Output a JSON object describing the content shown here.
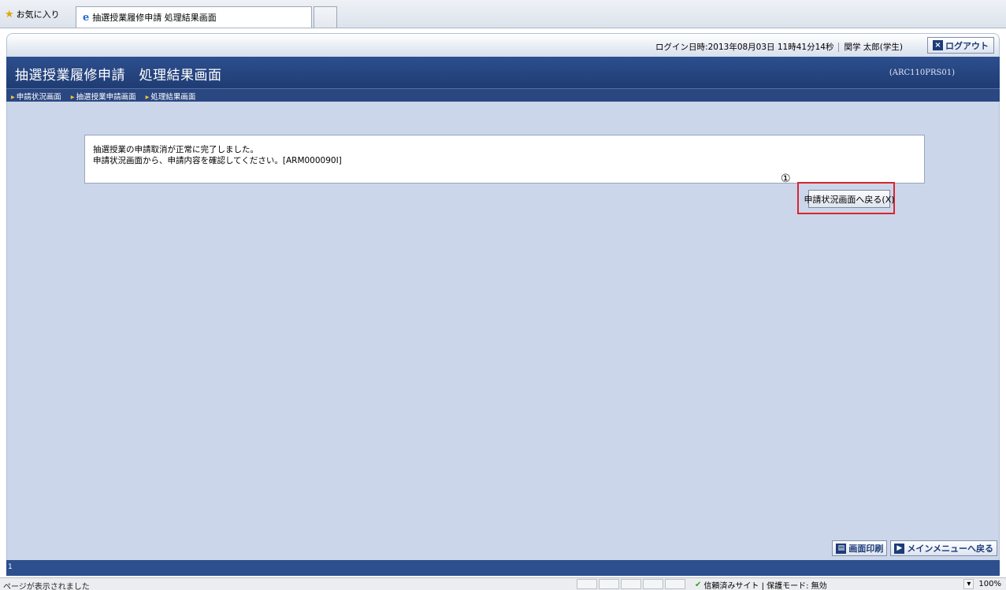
{
  "browser": {
    "favorites_label": "お気に入り",
    "tab_title": "抽選授業履修申請 処理結果画面",
    "status_text": "ページが表示されました",
    "security_zone": "信頼済みサイト | 保護モード: 無効",
    "zoom": "100%"
  },
  "header": {
    "login_label": "ログイン日時:",
    "login_datetime": "2013年08月03日 11時41分14秒",
    "user": "関学 太郎(学生)",
    "logout_label": "ログアウト"
  },
  "page": {
    "title": "抽選授業履修申請　処理結果画面",
    "screen_id": "(ARC110PRS01)",
    "breadcrumbs": [
      "申請状況画面",
      "抽選授業申請画面",
      "処理結果画面"
    ]
  },
  "message": {
    "line1": "抽選授業の申請取消が正常に完了しました。",
    "line2": "申請状況画面から、申請内容を確認してください。[ARM000090I]"
  },
  "annotation": {
    "marker": "①"
  },
  "buttons": {
    "back_to_status": "申請状況画面へ戻る(X)",
    "print": "画面印刷",
    "main_menu": "メインメニューへ戻る"
  },
  "footer": {
    "page_number": "1"
  }
}
